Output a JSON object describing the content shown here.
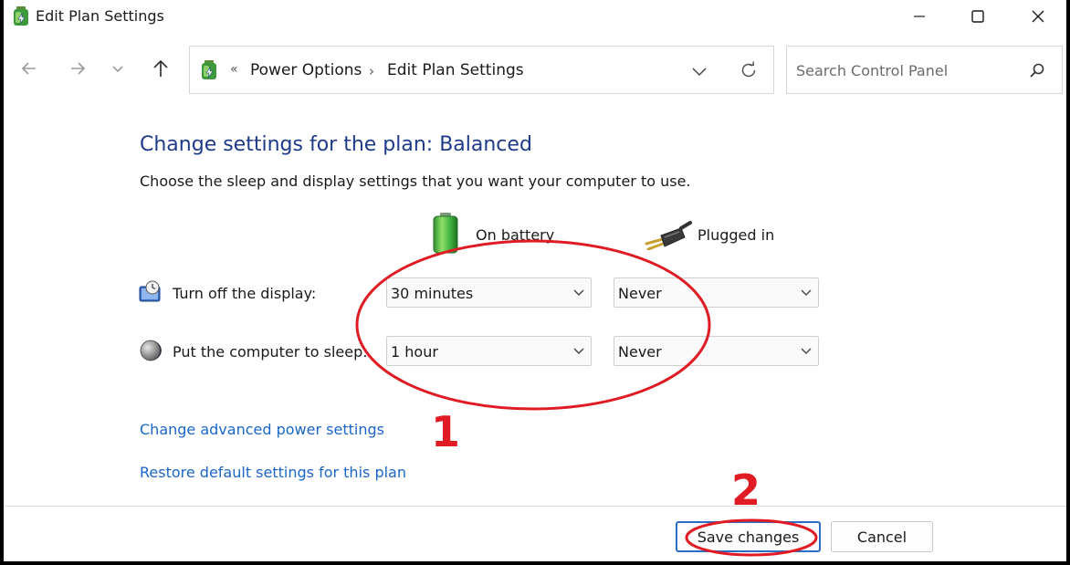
{
  "window": {
    "title": "Edit Plan Settings"
  },
  "nav": {
    "breadcrumb_sep0": "«",
    "crumbs": [
      "Power Options",
      "Edit Plan Settings"
    ],
    "crumb_sep": "›",
    "search_placeholder": "Search Control Panel"
  },
  "content": {
    "heading": "Change settings for the plan: Balanced",
    "description": "Choose the sleep and display settings that you want your computer to use.",
    "columns": {
      "battery": "On battery",
      "plugged": "Plugged in"
    },
    "rows": [
      {
        "label": "Turn off the display:",
        "battery": "30 minutes",
        "plugged": "Never",
        "icon": "display-clock-icon"
      },
      {
        "label": "Put the computer to sleep:",
        "battery": "1 hour",
        "plugged": "Never",
        "icon": "moon-sleep-icon"
      }
    ],
    "links": {
      "advanced": "Change advanced power settings",
      "restore": "Restore default settings for this plan"
    }
  },
  "footer": {
    "save_label": "Save changes",
    "cancel_label": "Cancel"
  },
  "annotations": {
    "num1": "1",
    "num2": "2",
    "color": "#e01b24"
  }
}
